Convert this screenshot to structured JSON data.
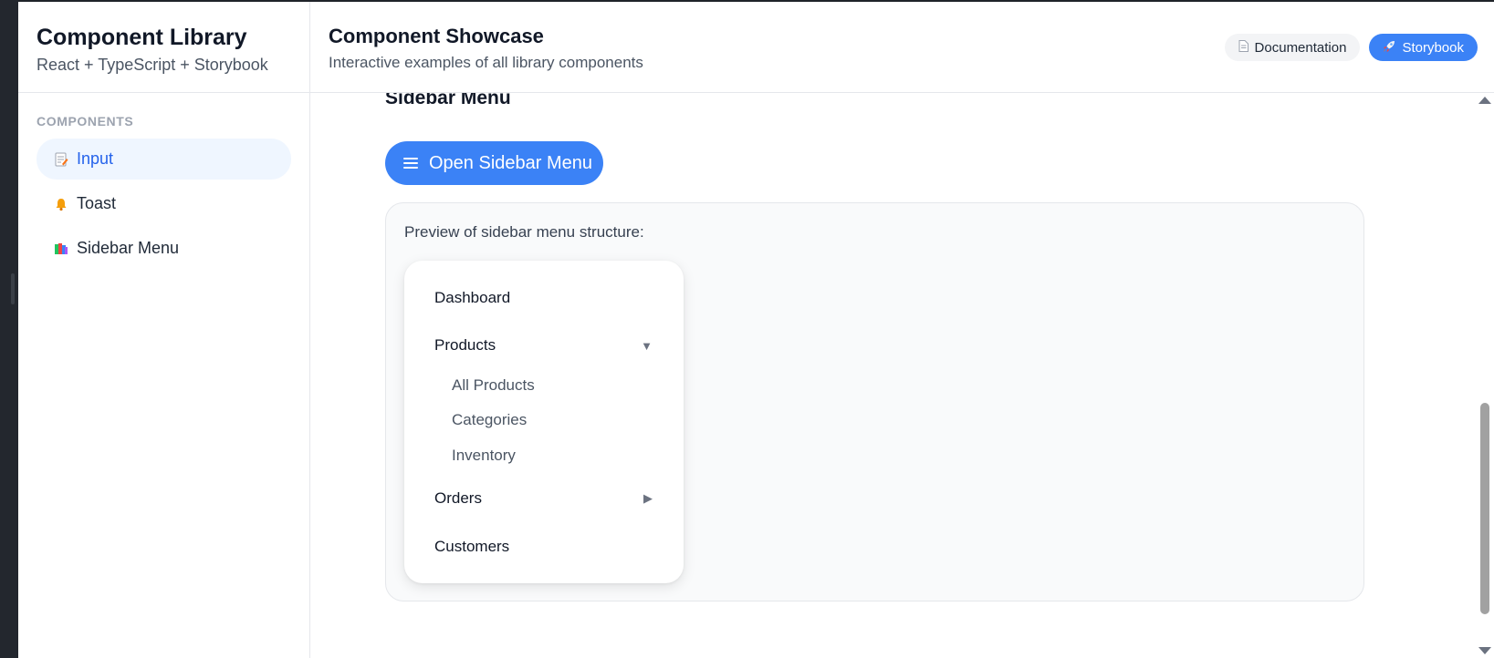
{
  "sidebar": {
    "title": "Component Library",
    "subtitle": "React + TypeScript + Storybook",
    "section_label": "COMPONENTS",
    "items": [
      {
        "label": "Input",
        "icon": "memo-icon"
      },
      {
        "label": "Toast",
        "icon": "bell-icon"
      },
      {
        "label": "Sidebar Menu",
        "icon": "books-icon"
      }
    ]
  },
  "header": {
    "title": "Component Showcase",
    "subtitle": "Interactive examples of all library components",
    "doc_label": "Documentation",
    "storybook_label": "Storybook"
  },
  "section": {
    "title": "Sidebar Menu",
    "open_button_label": "Open Sidebar Menu",
    "preview_label": "Preview of sidebar menu structure:"
  },
  "menu": {
    "dashboard": "Dashboard",
    "products": "Products",
    "products_children": [
      "All Products",
      "Categories",
      "Inventory"
    ],
    "orders": "Orders",
    "customers": "Customers",
    "expanded_caret": "▼",
    "collapsed_caret": "▶"
  },
  "colors": {
    "accent": "#3b82f6",
    "active_bg": "#eff6ff",
    "active_text": "#2563eb"
  }
}
